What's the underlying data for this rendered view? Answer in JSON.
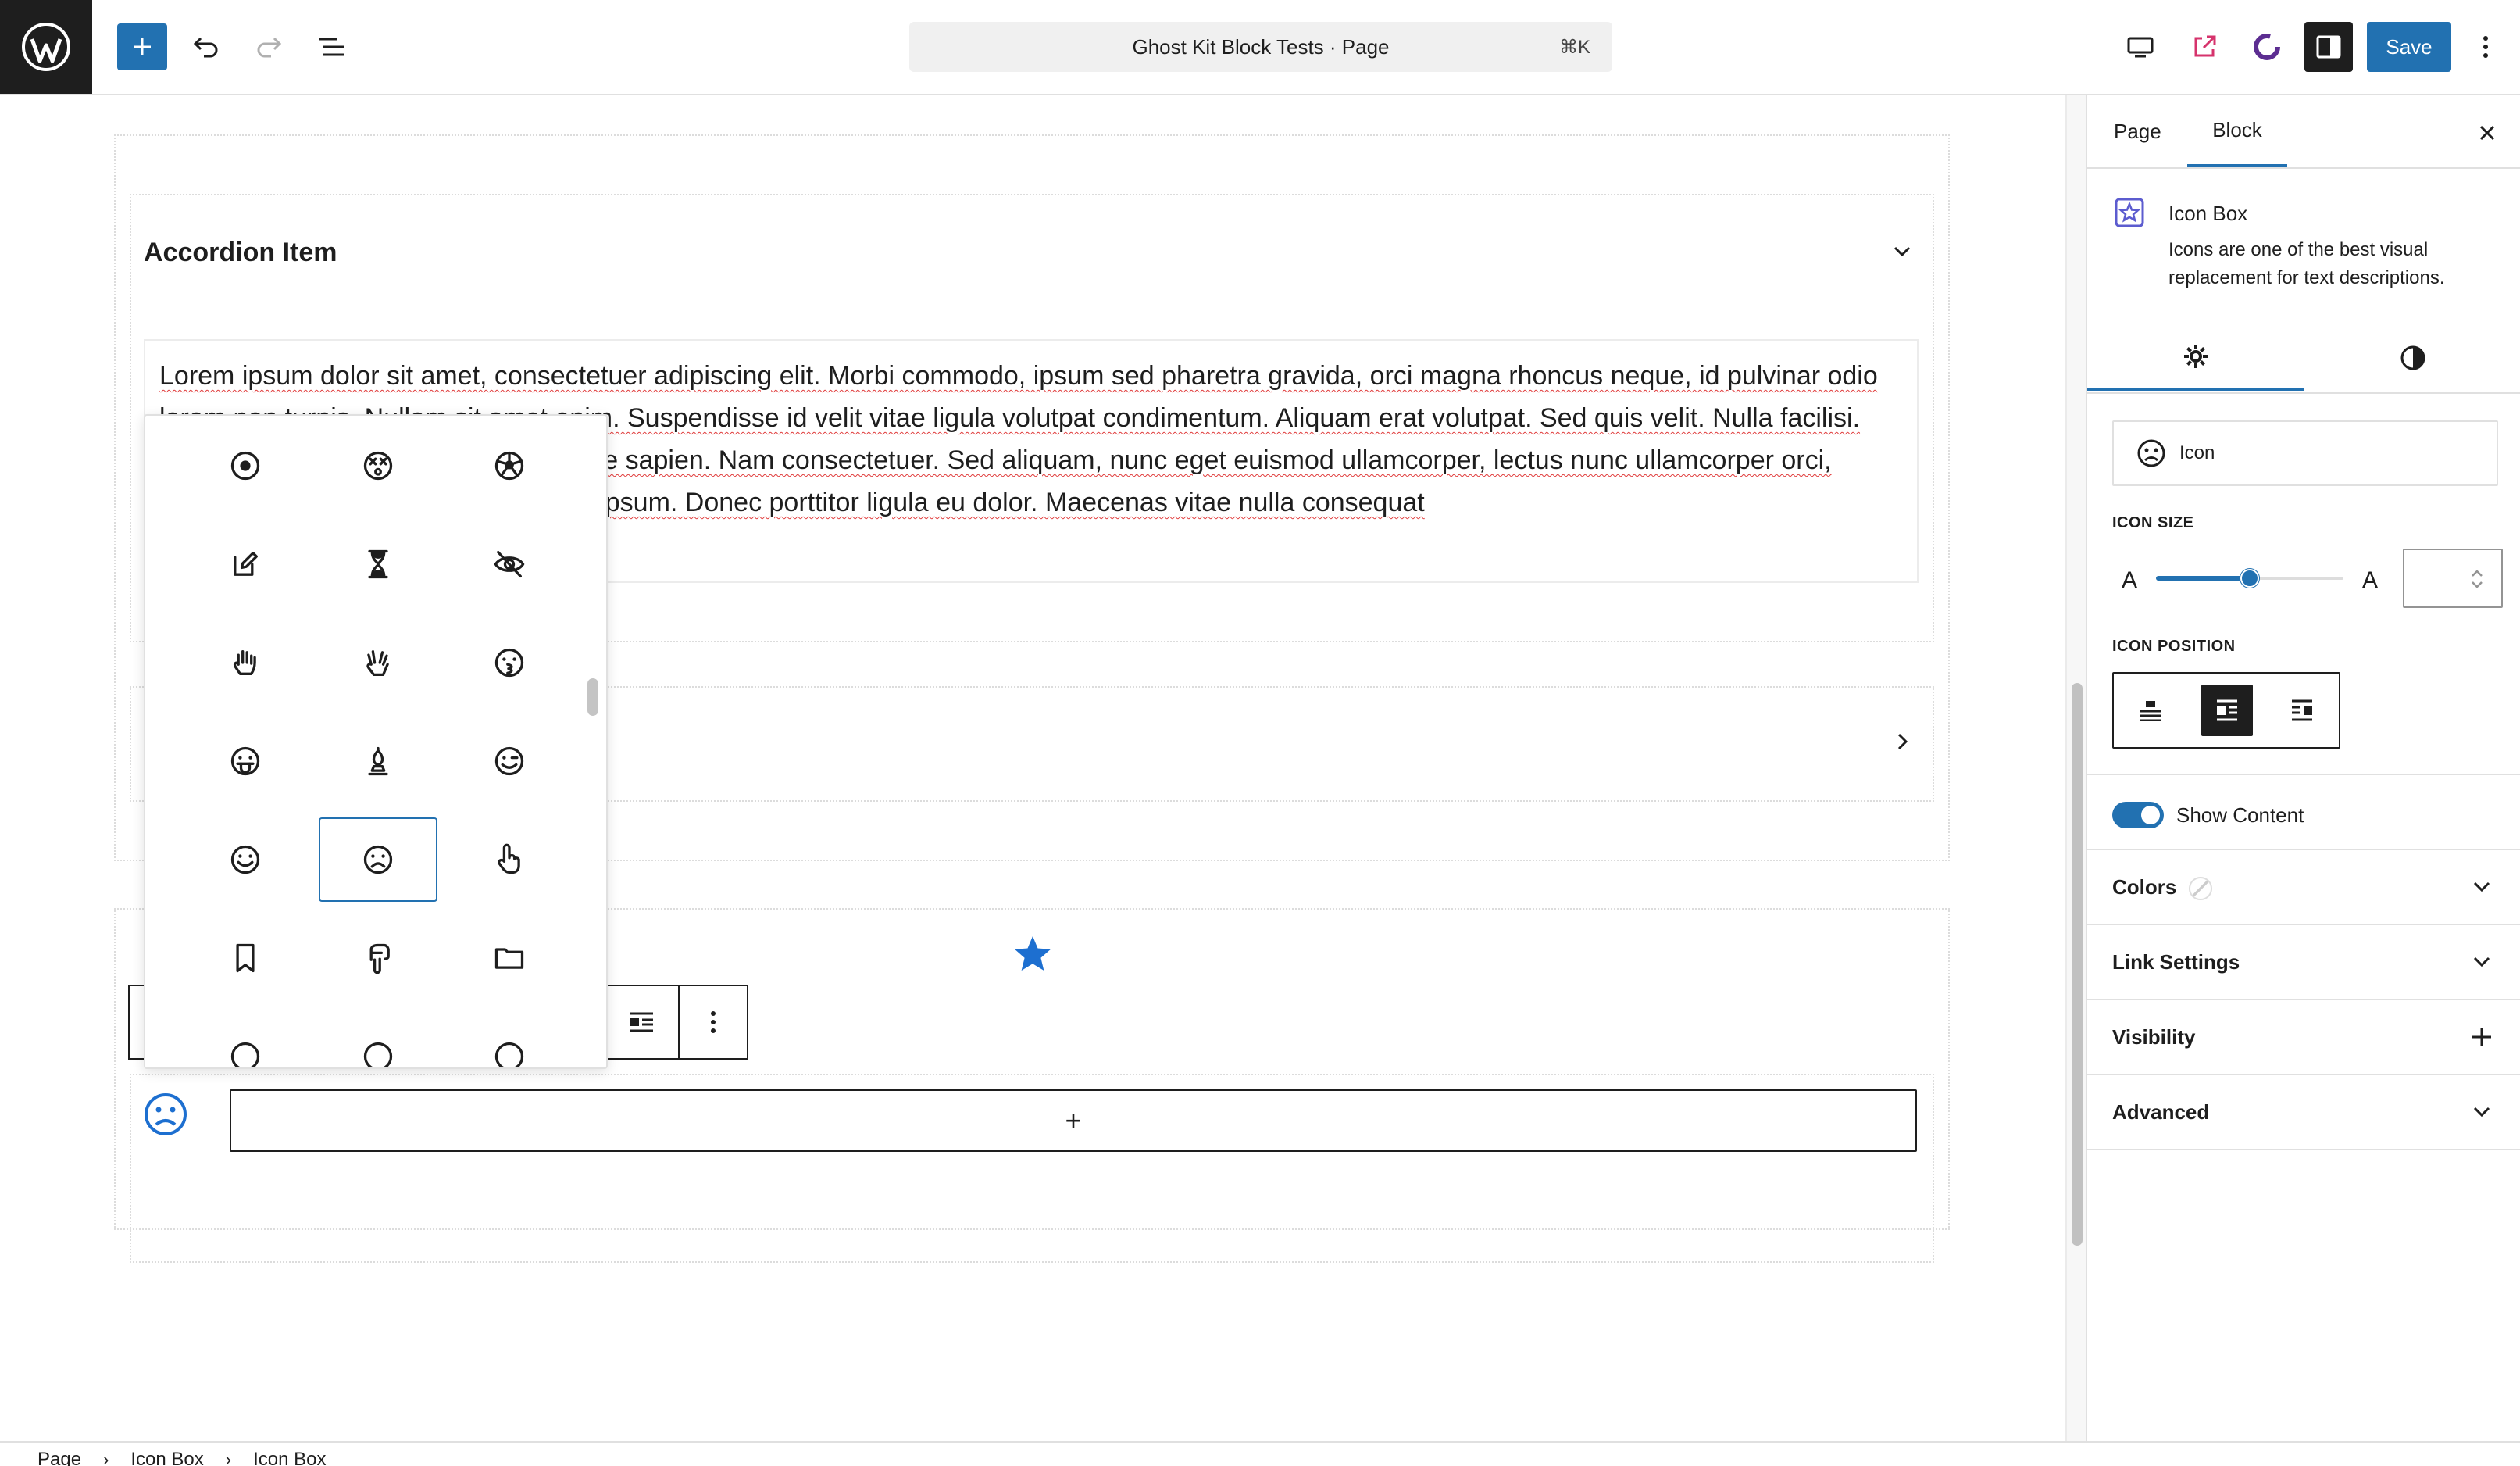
{
  "header": {
    "title": "Ghost Kit Block Tests · Page",
    "shortcut": "⌘K",
    "save_label": "Save"
  },
  "editor": {
    "accordion_title": "Accordion Item",
    "accordion_text": "Lorem ipsum dolor sit amet, consectetuer adipiscing elit. Morbi commodo, ipsum sed pharetra gravida, orci magna rhoncus neque, id pulvinar odio lorem non turpis. Nullam sit amet enim. Suspendisse id velit vitae ligula volutpat condimentum. Aliquam erat volutpat. Sed quis velit. Nulla facilisi. Nulla libero. Vivamus pharetra posuere sapien. Nam consectetuer. Sed aliquam, nunc eget euismod ullamcorper, lectus nunc ullamcorper orci, fermentum bibendum enim nibh eget ipsum. Donec porttitor ligula eu dolor. Maecenas vitae nulla consequat",
    "appender_label": "+"
  },
  "icon_picker": {
    "icons": [
      "dot-circle-icon",
      "dizzy-face-icon",
      "football-icon",
      "edit-icon",
      "hourglass-icon",
      "eye-slash-icon",
      "hand-paper-icon",
      "hand-spock-icon",
      "kiss-face-icon",
      "grin-tongue-icon",
      "chess-bishop-icon",
      "wink-face-icon",
      "smile-face-icon",
      "frown-face-icon",
      "hand-pointer-icon",
      "bookmark-icon",
      "hand-point-down-icon",
      "folder-icon"
    ],
    "selected": "frown-face-icon"
  },
  "sidebar": {
    "tabs": [
      "Page",
      "Block"
    ],
    "active_tab": "Block",
    "block_title": "Icon Box",
    "block_description": "Icons are one of the best visual replacement for text descriptions.",
    "icon_label": "Icon",
    "icon_size_label": "ICON SIZE",
    "size_small": "A",
    "size_large": "A",
    "icon_size_level": 0.5,
    "icon_position_label": "ICON POSITION",
    "icon_position_selected": "left",
    "show_content_label": "Show Content",
    "show_content_on": true,
    "panels": [
      "Colors",
      "Link Settings",
      "Visibility",
      "Advanced"
    ]
  },
  "breadcrumbs": [
    "Page",
    "Icon Box",
    "Icon Box"
  ],
  "colors": {
    "accent": "#2271b1",
    "dark": "#1e1e1e",
    "ghostkit_ring": "#5c2d91",
    "external_link": "#d6336c"
  }
}
